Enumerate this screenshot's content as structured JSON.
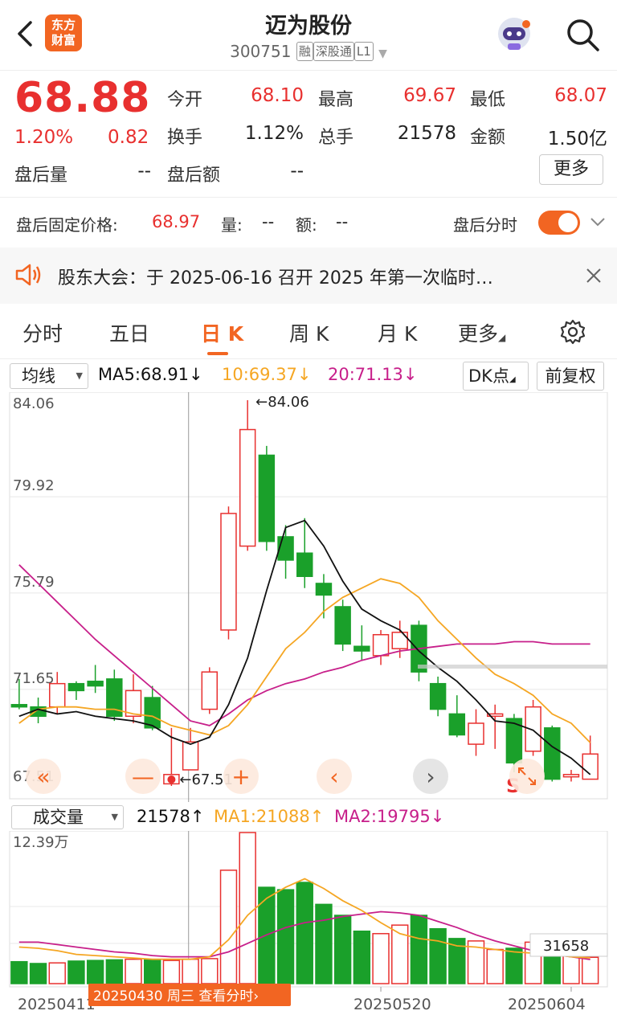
{
  "header": {
    "title": "迈为股份",
    "code": "300751",
    "tags": [
      "融",
      "深股通",
      "L1"
    ],
    "logo_text": [
      "东方",
      "财富"
    ],
    "icons": {
      "back": "back-arrow-icon",
      "robot": "robot-assistant-icon",
      "search": "search-icon"
    }
  },
  "quote": {
    "price": "68.88",
    "change_pct": "1.20%",
    "change": "0.82",
    "open_label": "今开",
    "open": "68.10",
    "high_label": "最高",
    "high": "69.67",
    "low_label": "最低",
    "low": "68.07",
    "turnover_label": "换手",
    "turnover": "1.12%",
    "volume_label": "总手",
    "volume": "21578",
    "amount_label": "金额",
    "amount": "1.50亿",
    "after_vol_label": "盘后量",
    "after_vol": "--",
    "after_amt_label": "盘后额",
    "after_amt": "--",
    "more_label": "更多"
  },
  "after_hours": {
    "fixed_price_label": "盘后固定价格:",
    "fixed_price": "68.97",
    "qty_label": "量:",
    "qty": "--",
    "amt_label": "额:",
    "amt": "--",
    "timeshare_label": "盘后分时",
    "toggle_on": true
  },
  "notice": {
    "text": "股东大会：于 2025-06-16 召开 2025 年第一次临时…"
  },
  "tabs": {
    "items": [
      "分时",
      "五日",
      "日 K",
      "周 K",
      "月 K",
      "更多"
    ],
    "active": "日 K"
  },
  "indicators": {
    "ma_select": "均线",
    "ma5": "MA5:68.91",
    "ma10": "10:69.37",
    "ma20": "20:71.13",
    "dk_label": "DK点",
    "adjust_label": "前复权"
  },
  "colors": {
    "up": "#e8302f",
    "down": "#1aa02a",
    "ma5": "#111111",
    "ma10": "#f5a623",
    "ma20": "#c71f8a",
    "accent": "#f26522"
  },
  "chart_data": {
    "type": "candlestick",
    "y_ticks": [
      "84.06",
      "79.92",
      "75.79",
      "71.65",
      "67.51"
    ],
    "ylim": [
      67.51,
      84.06
    ],
    "max_label": "84.06",
    "min_label": "67.51",
    "candles": [
      {
        "o": 71.0,
        "c": 70.9,
        "h": 72.1,
        "l": 70.8
      },
      {
        "o": 70.9,
        "c": 70.5,
        "h": 71.3,
        "l": 70.2
      },
      {
        "o": 70.9,
        "c": 71.9,
        "h": 72.4,
        "l": 70.6
      },
      {
        "o": 71.9,
        "c": 71.6,
        "h": 72.0,
        "l": 71.2
      },
      {
        "o": 72.0,
        "c": 71.8,
        "h": 72.7,
        "l": 71.5
      },
      {
        "o": 72.1,
        "c": 70.5,
        "h": 72.5,
        "l": 70.3
      },
      {
        "o": 70.5,
        "c": 71.6,
        "h": 72.3,
        "l": 70.2
      },
      {
        "o": 71.3,
        "c": 70.0,
        "h": 71.8,
        "l": 69.9
      },
      {
        "o": 67.6,
        "c": 68.0,
        "h": 70.0,
        "l": 67.51
      },
      {
        "o": 68.2,
        "c": 69.4,
        "h": 70.0,
        "l": 68.2
      },
      {
        "o": 70.8,
        "c": 72.4,
        "h": 72.6,
        "l": 70.6
      },
      {
        "o": 74.2,
        "c": 79.2,
        "h": 79.5,
        "l": 73.8
      },
      {
        "o": 77.8,
        "c": 82.8,
        "h": 84.06,
        "l": 77.6
      },
      {
        "o": 81.7,
        "c": 78.0,
        "h": 82.1,
        "l": 77.6
      },
      {
        "o": 78.2,
        "c": 77.2,
        "h": 78.7,
        "l": 76.4
      },
      {
        "o": 77.5,
        "c": 76.5,
        "h": 79.0,
        "l": 76.0
      },
      {
        "o": 76.2,
        "c": 75.7,
        "h": 76.6,
        "l": 74.7
      },
      {
        "o": 75.2,
        "c": 73.6,
        "h": 75.5,
        "l": 73.3
      },
      {
        "o": 73.5,
        "c": 73.3,
        "h": 74.4,
        "l": 72.9
      },
      {
        "o": 73.1,
        "c": 74.0,
        "h": 74.2,
        "l": 72.7
      },
      {
        "o": 73.4,
        "c": 74.1,
        "h": 74.6,
        "l": 73.0
      },
      {
        "o": 74.4,
        "c": 72.4,
        "h": 74.6,
        "l": 72.0
      },
      {
        "o": 71.9,
        "c": 70.8,
        "h": 72.2,
        "l": 70.5
      },
      {
        "o": 70.6,
        "c": 69.7,
        "h": 71.4,
        "l": 69.6
      },
      {
        "o": 69.3,
        "c": 70.2,
        "h": 70.8,
        "l": 68.8
      },
      {
        "o": 70.5,
        "c": 70.6,
        "h": 71.0,
        "l": 69.1
      },
      {
        "o": 70.4,
        "c": 68.5,
        "h": 70.6,
        "l": 68.1
      },
      {
        "o": 69.0,
        "c": 70.9,
        "h": 71.2,
        "l": 68.8
      },
      {
        "o": 70.0,
        "c": 67.8,
        "h": 70.1,
        "l": 67.7
      },
      {
        "o": 67.9,
        "c": 68.0,
        "h": 68.2,
        "l": 67.7
      },
      {
        "o": 67.8,
        "c": 68.88,
        "h": 69.67,
        "l": 68.07
      }
    ],
    "ma5": [
      70.5,
      70.8,
      70.6,
      70.7,
      70.5,
      70.4,
      70.3,
      70.1,
      69.6,
      69.3,
      69.6,
      71.0,
      73.0,
      75.9,
      78.6,
      78.9,
      77.8,
      76.3,
      75.1,
      74.6,
      74.2,
      73.3,
      72.6,
      72.0,
      71.2,
      70.3,
      70.2,
      69.9,
      69.2,
      68.7,
      68.0
    ],
    "ma10": [
      70.2,
      70.8,
      70.9,
      70.9,
      70.8,
      70.8,
      70.6,
      70.5,
      70.1,
      69.9,
      69.7,
      70.1,
      71.0,
      72.2,
      73.4,
      74.1,
      75.0,
      75.6,
      76.0,
      76.4,
      76.2,
      75.6,
      74.6,
      73.8,
      73.0,
      72.3,
      71.9,
      71.4,
      70.6,
      70.2,
      69.37
    ],
    "ma20": [
      77.0,
      76.2,
      75.4,
      74.6,
      73.8,
      73.1,
      72.4,
      71.7,
      71.0,
      70.3,
      70.1,
      70.6,
      71.2,
      71.6,
      71.9,
      72.1,
      72.4,
      72.6,
      72.9,
      73.1,
      73.3,
      73.4,
      73.5,
      73.6,
      73.6,
      73.6,
      73.7,
      73.7,
      73.6,
      73.6,
      73.6
    ],
    "volume": {
      "select": "成交量",
      "current": "21578",
      "ma1": "MA1:21088",
      "ma2": "MA2:19795",
      "y_top": "12.39万",
      "ylim": [
        0,
        123900
      ],
      "values": [
        18000,
        16500,
        17000,
        18500,
        19000,
        19500,
        20000,
        19500,
        19000,
        20000,
        20500,
        93000,
        123900,
        79000,
        77000,
        83000,
        65000,
        56000,
        43000,
        41000,
        48000,
        56000,
        45000,
        37000,
        35000,
        28000,
        29000,
        34000,
        36000,
        39000,
        21578
      ],
      "ma1_line": [
        30000,
        29000,
        27000,
        24000,
        23000,
        22000,
        21000,
        20000,
        20000,
        20000,
        22000,
        36000,
        56000,
        70000,
        79000,
        86000,
        78000,
        68000,
        60000,
        50000,
        41000,
        37000,
        35000,
        31000,
        30000,
        28000,
        26000,
        25000,
        24000,
        22000,
        21088
      ],
      "ma2_line": [
        34000,
        34000,
        32000,
        30000,
        28000,
        26000,
        25000,
        23000,
        22000,
        22000,
        22000,
        26000,
        33000,
        40000,
        46000,
        50000,
        52000,
        55000,
        57000,
        59000,
        58000,
        56000,
        51000,
        46000,
        40000,
        35000,
        31000,
        27000,
        24000,
        22000,
        19795
      ],
      "tooltip_value": "31658"
    },
    "x_ticks": [
      "20250411",
      "20250520",
      "20250604"
    ],
    "crosshair_label": "20250430 周三 查看分时"
  },
  "chart_controls": {
    "icons": [
      "rewind-icon",
      "zoom-out-icon",
      "zoom-in-icon",
      "prev-icon",
      "next-icon",
      "s-signal-icon",
      "fullscreen-icon"
    ],
    "s_label": "S"
  }
}
